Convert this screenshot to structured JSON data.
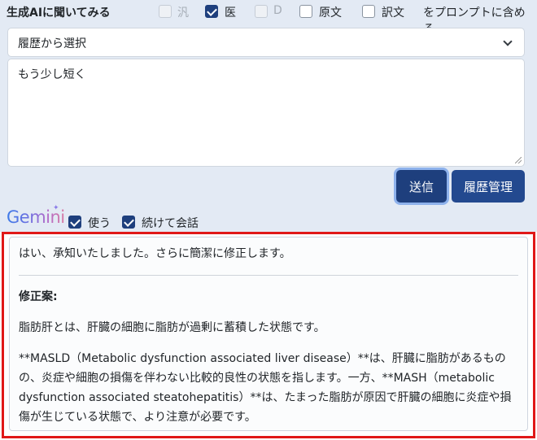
{
  "header": {
    "title": "生成AIに聞いてみる"
  },
  "options": [
    {
      "label": "汎",
      "checked": false,
      "disabled": true
    },
    {
      "label": "医",
      "checked": true,
      "disabled": false
    },
    {
      "label": "D",
      "checked": false,
      "disabled": true
    },
    {
      "label": "原文",
      "checked": false,
      "disabled": false
    },
    {
      "label": "訳文",
      "checked": false,
      "disabled": false
    }
  ],
  "options_suffix": "をプロンプトに含める",
  "history_select": {
    "selected": "履歴から選択"
  },
  "prompt_input": {
    "value": "もう少し短く"
  },
  "buttons": {
    "send": "送信",
    "history_manage": "履歴管理"
  },
  "gemini": {
    "logo_text": "Gemini",
    "use_label": "使う",
    "use_checked": true,
    "continue_label": "続けて会話",
    "continue_checked": true
  },
  "answer": {
    "intro": "はい、承知いたしました。さらに簡潔に修正します。",
    "heading": "修正案:",
    "paragraph1": "脂肪肝とは、肝臓の細胞に脂肪が過剰に蓄積した状態です。",
    "paragraph2": "**MASLD（Metabolic dysfunction associated liver disease）**は、肝臓に脂肪があるものの、炎症や細胞の損傷を伴わない比較的良性の状態を指します。一方、**MASH（metabolic dysfunction associated steatohepatitis）**は、たまった脂肪が原因で肝臓の細胞に炎症や損傷が生じている状態で、より注意が必要です。"
  }
}
